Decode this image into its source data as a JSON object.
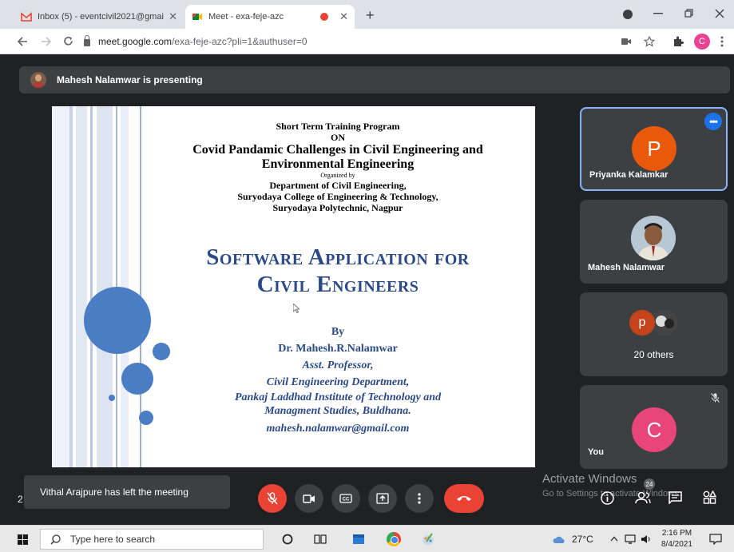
{
  "browser": {
    "tabs": [
      {
        "title": "Inbox (5) - eventcivil2021@gmai",
        "active": false
      },
      {
        "title": "Meet - exa-feje-azc",
        "active": true
      }
    ],
    "url_domain": "meet.google.com",
    "url_path": "/exa-feje-azc?pli=1&authuser=0",
    "profile_initial": "C",
    "new_tab_glyph": "+",
    "close_glyph": "✕"
  },
  "meet": {
    "presenting_text": "Mahesh Nalamwar is presenting",
    "slide": {
      "program_lines": [
        "Short Term Training Program",
        "ON"
      ],
      "main_title_lines": [
        "Covid Pandamic Challenges in Civil Engineering and",
        "Environmental Engineering"
      ],
      "organized_by": "Organized by",
      "dept_lines": [
        "Department of Civil Engineering,",
        "Suryodaya College of Engineering & Technology,",
        "Suryodaya Polytechnic, Nagpur"
      ],
      "talk_title_lines": [
        "Software Application for",
        "Civil Engineers"
      ],
      "by": "By",
      "author": "Dr. Mahesh.R.Nalamwar",
      "designation": "Asst. Professor,",
      "department": "Civil Engineering Department,",
      "institute_lines": [
        "Pankaj Laddhad Institute of Technology and",
        "Managment Studies, Buldhana."
      ],
      "email": "mahesh.nalamwar@gmail.com"
    },
    "participants": [
      {
        "name": "Priyanka Kalamkar",
        "initial": "P",
        "color": "#e8590c"
      },
      {
        "name": "Mahesh Nalamwar"
      },
      {
        "name": "20 others",
        "initial": "p",
        "color": "#c5441b"
      },
      {
        "name": "You",
        "initial": "C",
        "color": "#e8457a"
      }
    ],
    "toast": "Vithal Arajpure has left the meeting",
    "toast_left_char": "2",
    "watermark_title": "Activate Windows",
    "watermark_sub": "Go to Settings to activate Windows.",
    "participant_count": "24"
  },
  "taskbar": {
    "search_placeholder": "Type here to search",
    "temperature": "27°C",
    "time": "2:16 PM",
    "date": "8/4/2021"
  }
}
